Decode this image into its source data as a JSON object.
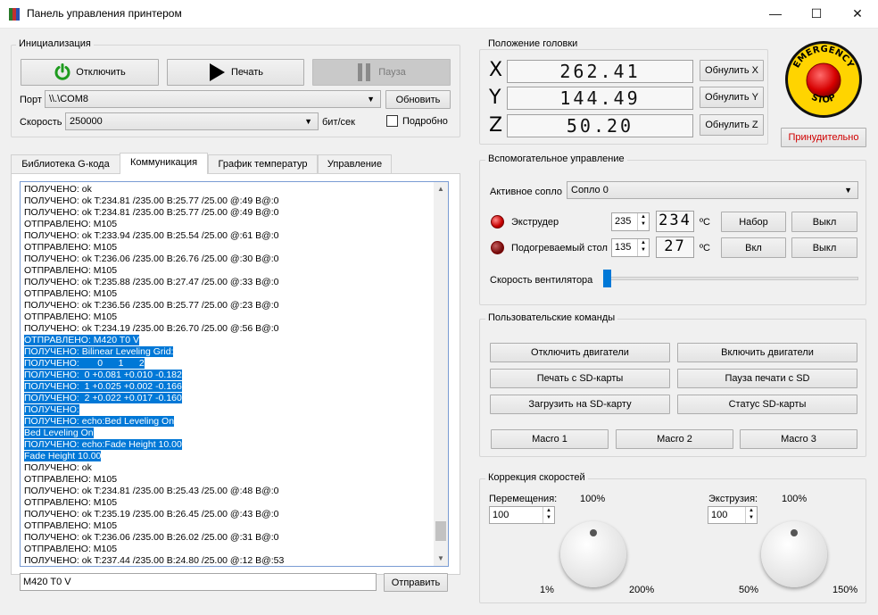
{
  "window": {
    "title": "Панель управления принтером",
    "minimize": "—",
    "maximize": "☐",
    "close": "✕"
  },
  "init": {
    "title": "Инициализация",
    "disconnect_label": "Отключить",
    "print_label": "Печать",
    "pause_label": "Пауза",
    "port_label": "Порт",
    "port_value": "\\\\.\\COM8",
    "refresh_label": "Обновить",
    "speed_label": "Скорость",
    "speed_value": "250000",
    "speed_unit": "бит/сек",
    "verbose_label": "Подробно"
  },
  "tabs": [
    {
      "label": "Библиотека G-кода"
    },
    {
      "label": "Коммуникация"
    },
    {
      "label": "График температур"
    },
    {
      "label": "Управление"
    }
  ],
  "log": {
    "lines": [
      {
        "text": "ПОЛУЧЕНО: ok",
        "selected": false
      },
      {
        "text": "ПОЛУЧЕНО: ok T:234.81 /235.00 B:25.77 /25.00 @:49 B@:0",
        "selected": false
      },
      {
        "text": "ПОЛУЧЕНО: ok T:234.81 /235.00 B:25.77 /25.00 @:49 B@:0",
        "selected": false
      },
      {
        "text": "ОТПРАВЛЕНО: M105",
        "selected": false
      },
      {
        "text": "ПОЛУЧЕНО: ok T:233.94 /235.00 B:25.54 /25.00 @:61 B@:0",
        "selected": false
      },
      {
        "text": "ОТПРАВЛЕНО: M105",
        "selected": false
      },
      {
        "text": "ПОЛУЧЕНО: ok T:236.06 /235.00 B:26.76 /25.00 @:30 B@:0",
        "selected": false
      },
      {
        "text": "ОТПРАВЛЕНО: M105",
        "selected": false
      },
      {
        "text": "ПОЛУЧЕНО: ok T:235.88 /235.00 B:27.47 /25.00 @:33 B@:0",
        "selected": false
      },
      {
        "text": "ОТПРАВЛЕНО: M105",
        "selected": false
      },
      {
        "text": "ПОЛУЧЕНО: ok T:236.56 /235.00 B:25.77 /25.00 @:23 B@:0",
        "selected": false
      },
      {
        "text": "ОТПРАВЛЕНО: M105",
        "selected": false
      },
      {
        "text": "ПОЛУЧЕНО: ok T:234.19 /235.00 B:26.70 /25.00 @:56 B@:0",
        "selected": false
      },
      {
        "text": "ОТПРАВЛЕНО: M420 T0 V",
        "selected": true
      },
      {
        "text": "ПОЛУЧЕНО: Bilinear Leveling Grid:",
        "selected": true
      },
      {
        "text": "ПОЛУЧЕНО:       0      1      2",
        "selected": true
      },
      {
        "text": "ПОЛУЧЕНО:  0 +0.081 +0.010 -0.182",
        "selected": true
      },
      {
        "text": "ПОЛУЧЕНО:  1 +0.025 +0.002 -0.166",
        "selected": true
      },
      {
        "text": "ПОЛУЧЕНО:  2 +0.022 +0.017 -0.160",
        "selected": true
      },
      {
        "text": "ПОЛУЧЕНО:",
        "selected": true
      },
      {
        "text": "ПОЛУЧЕНО: echo:Bed Leveling On",
        "selected": true
      },
      {
        "text": "Bed Leveling On",
        "selected": true
      },
      {
        "text": "ПОЛУЧЕНО: echo:Fade Height 10.00",
        "selected": true
      },
      {
        "text": "Fade Height 10.00",
        "selected": true
      },
      {
        "text": "ПОЛУЧЕНО: ok",
        "selected": false
      },
      {
        "text": "ОТПРАВЛЕНО: M105",
        "selected": false
      },
      {
        "text": "ПОЛУЧЕНО: ok T:234.81 /235.00 B:25.43 /25.00 @:48 B@:0",
        "selected": false
      },
      {
        "text": "ОТПРАВЛЕНО: M105",
        "selected": false
      },
      {
        "text": "ПОЛУЧЕНО: ok T:235.19 /235.00 B:26.45 /25.00 @:43 B@:0",
        "selected": false
      },
      {
        "text": "ОТПРАВЛЕНО: M105",
        "selected": false
      },
      {
        "text": "ПОЛУЧЕНО: ok T:236.06 /235.00 B:26.02 /25.00 @:31 B@:0",
        "selected": false
      },
      {
        "text": "ОТПРАВЛЕНО: M105",
        "selected": false
      },
      {
        "text": "ПОЛУЧЕНО: ok T:237.44 /235.00 B:24.80 /25.00 @:12 B@:53",
        "selected": false
      }
    ],
    "command_value": "M420 T0 V",
    "send_label": "Отправить"
  },
  "head": {
    "title": "Положение головки",
    "axes": [
      {
        "letter": "X",
        "value": "262.41",
        "reset_label": "Обнулить X"
      },
      {
        "letter": "Y",
        "value": "144.49",
        "reset_label": "Обнулить Y"
      },
      {
        "letter": "Z",
        "value": "50.20",
        "reset_label": "Обнулить Z"
      }
    ]
  },
  "emergency": {
    "top_text": "EMERGENCY",
    "bottom_text": "STOP",
    "force_label": "Принудительно",
    "force_color": "#d10000"
  },
  "aux": {
    "title": "Вспомогательное управление",
    "nozzle_label": "Активное сопло",
    "nozzle_value": "Сопло 0",
    "extruder_label": "Экструдер",
    "extruder_target": "235",
    "extruder_current": "234",
    "extruder_unit": "ºC",
    "extruder_set_label": "Набор",
    "extruder_off_label": "Выкл",
    "bed_label": "Подогреваемый стол",
    "bed_target": "135",
    "bed_current": "27",
    "bed_unit": "ºC",
    "bed_on_label": "Вкл",
    "bed_off_label": "Выкл",
    "fan_label": "Скорость вентилятора",
    "fan_level": 0
  },
  "custom": {
    "title": "Пользовательские команды",
    "motors_off": "Отключить двигатели",
    "motors_on": "Включить двигатели",
    "print_sd": "Печать с SD-карты",
    "pause_sd": "Пауза печати с SD",
    "upload_sd": "Загрузить на SD-карту",
    "status_sd": "Статус SD-карты",
    "macro1": "Macro 1",
    "macro2": "Macro 2",
    "macro3": "Macro 3"
  },
  "speed": {
    "title": "Коррекция скоростей",
    "move_label": "Перемещения:",
    "move_value": "100",
    "move_center": "100%",
    "move_min": "1%",
    "move_max": "200%",
    "extrude_label": "Экструзия:",
    "extrude_value": "100",
    "extrude_center": "100%",
    "extrude_min": "50%",
    "extrude_max": "150%"
  }
}
